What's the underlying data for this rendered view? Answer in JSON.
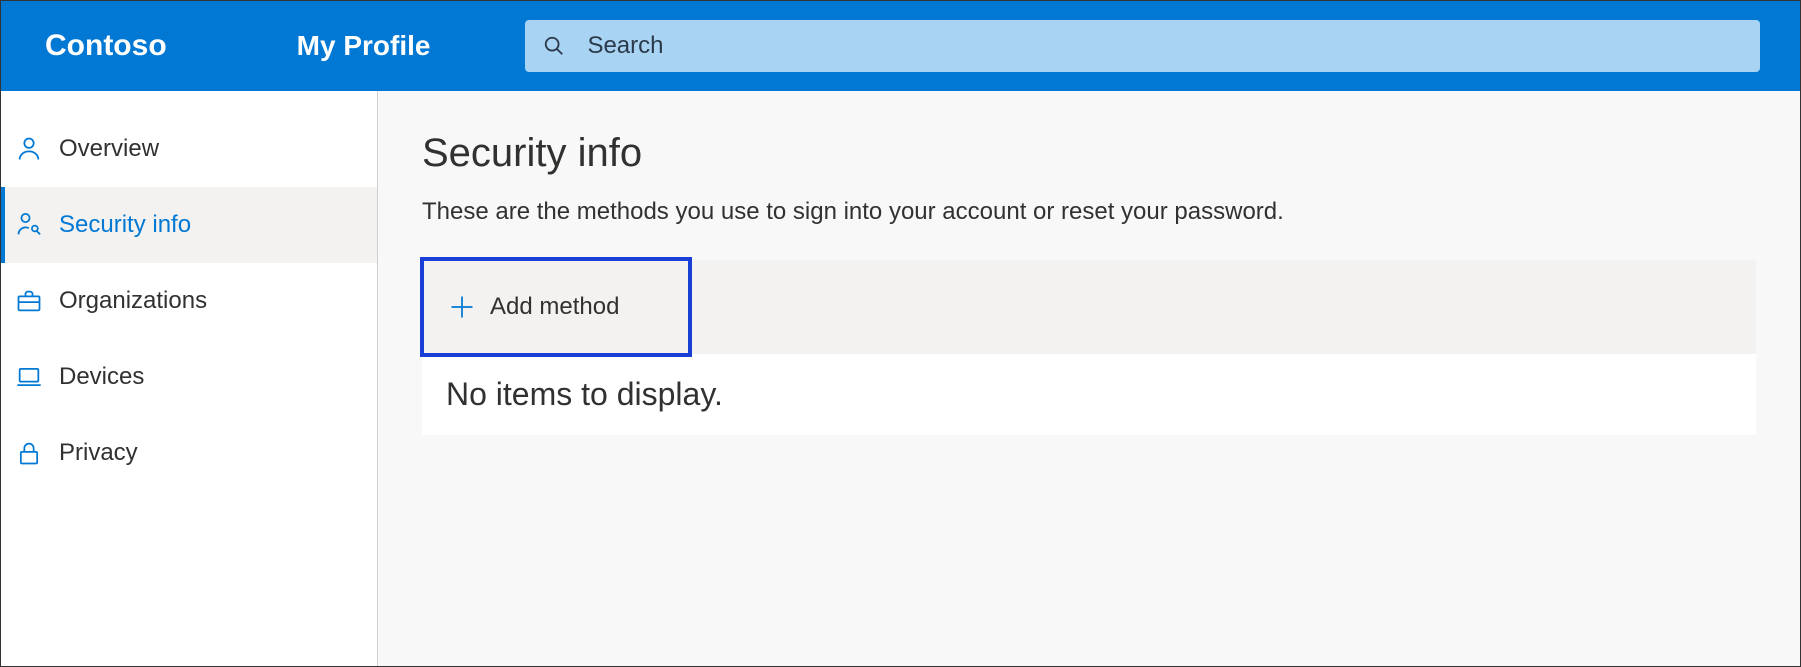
{
  "header": {
    "brand": "Contoso",
    "profile_label": "My Profile",
    "search_placeholder": "Search"
  },
  "sidebar": {
    "items": [
      {
        "label": "Overview",
        "icon": "person-icon",
        "active": false
      },
      {
        "label": "Security info",
        "icon": "person-key-icon",
        "active": true
      },
      {
        "label": "Organizations",
        "icon": "briefcase-icon",
        "active": false
      },
      {
        "label": "Devices",
        "icon": "laptop-icon",
        "active": false
      },
      {
        "label": "Privacy",
        "icon": "lock-icon",
        "active": false
      }
    ]
  },
  "main": {
    "title": "Security info",
    "subtitle": "These are the methods you use to sign into your account or reset your password.",
    "add_method_label": "Add method",
    "no_items_text": "No items to display."
  }
}
